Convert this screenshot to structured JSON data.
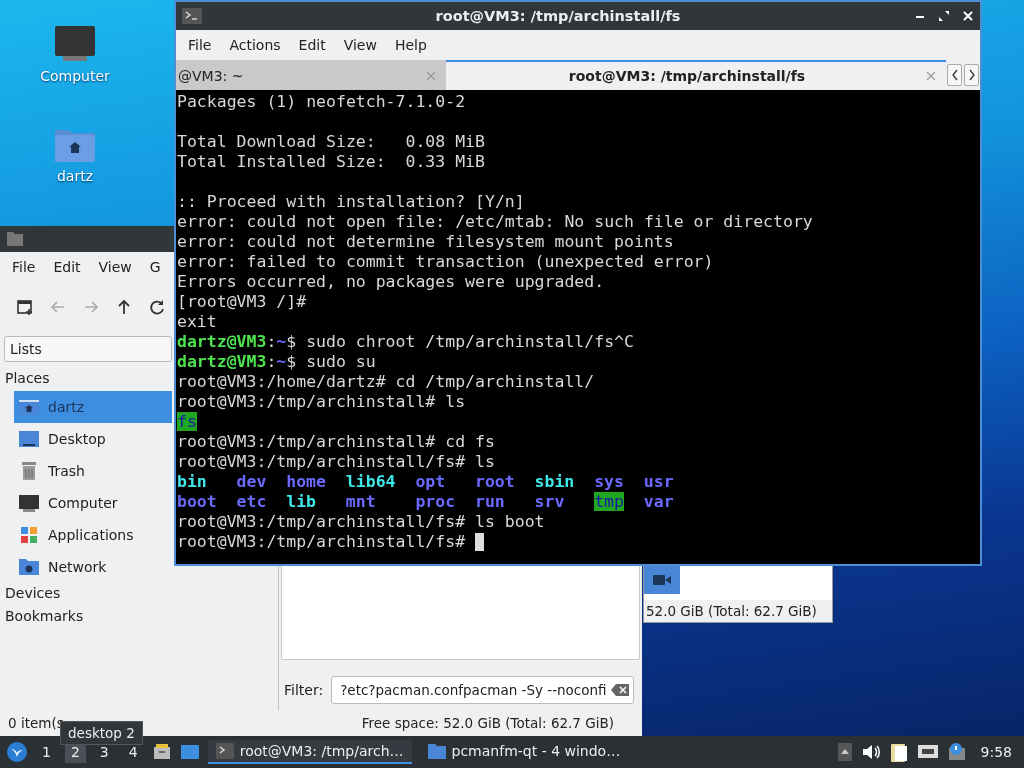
{
  "desktop_icons": [
    {
      "label": "Computer",
      "kind": "computer"
    },
    {
      "label": "dartz",
      "kind": "home"
    }
  ],
  "back_window": {
    "status": "52.0 GiB (Total: 62.7 GiB)"
  },
  "file_manager": {
    "menu": [
      "File",
      "Edit",
      "View",
      "G"
    ],
    "lists": "Lists",
    "places": {
      "label": "Places",
      "items": [
        {
          "label": "dartz",
          "selected": true
        },
        {
          "label": "Desktop",
          "selected": false
        },
        {
          "label": "Trash",
          "selected": false
        },
        {
          "label": "Computer",
          "selected": false
        },
        {
          "label": "Applications",
          "selected": false
        },
        {
          "label": "Network",
          "selected": false
        }
      ]
    },
    "sections": [
      "Devices",
      "Bookmarks"
    ],
    "filter": {
      "label": "Filter:",
      "value": "?etc?pacman.confpacman -Sy --noconfi"
    },
    "status": "0 item(s",
    "free_space": "Free space: 52.0 GiB (Total: 62.7 GiB)"
  },
  "terminal": {
    "title": "root@VM3: /tmp/archinstall/fs",
    "menu": [
      "File",
      "Actions",
      "Edit",
      "View",
      "Help"
    ],
    "tabs": [
      {
        "label": "@VM3: ~",
        "selected": false
      },
      {
        "label": "root@VM3: /tmp/archinstall/fs",
        "selected": true
      }
    ],
    "lines": [
      {
        "kind": "plain",
        "text": "Packages (1) neofetch-7.1.0-2"
      },
      {
        "kind": "blank"
      },
      {
        "kind": "plain",
        "text": "Total Download Size:   0.08 MiB"
      },
      {
        "kind": "plain",
        "text": "Total Installed Size:  0.33 MiB"
      },
      {
        "kind": "blank"
      },
      {
        "kind": "plain",
        "text": ":: Proceed with installation? [Y/n]"
      },
      {
        "kind": "plain",
        "text": "error: could not open file: /etc/mtab: No such file or directory"
      },
      {
        "kind": "plain",
        "text": "error: could not determine filesystem mount points"
      },
      {
        "kind": "plain",
        "text": "error: failed to commit transaction (unexpected error)"
      },
      {
        "kind": "plain",
        "text": "Errors occurred, no packages were upgraded."
      },
      {
        "kind": "plain",
        "text": "[root@VM3 /]#"
      },
      {
        "kind": "plain",
        "text": "exit"
      },
      {
        "kind": "prompt",
        "user": "dartz@VM3",
        "sep": ":",
        "path": "~",
        "command": "$ sudo chroot /tmp/archinstall/fs^C"
      },
      {
        "kind": "prompt",
        "user": "dartz@VM3",
        "sep": ":",
        "path": "~",
        "command": "$ sudo su"
      },
      {
        "kind": "plain",
        "text": "root@VM3:/home/dartz# cd /tmp/archinstall/"
      },
      {
        "kind": "plain",
        "text": "root@VM3:/tmp/archinstall# ls"
      },
      {
        "kind": "listing",
        "items": [
          {
            "text": "fs",
            "kind": "highlight"
          }
        ]
      },
      {
        "kind": "plain",
        "text": "root@VM3:/tmp/archinstall# cd fs"
      },
      {
        "kind": "plain",
        "text": "root@VM3:/tmp/archinstall/fs# ls"
      },
      {
        "kind": "listing",
        "items": [
          {
            "text": "bin",
            "kind": "link"
          },
          {
            "text": "dev",
            "kind": "dir"
          },
          {
            "text": "home",
            "kind": "dir"
          },
          {
            "text": "lib64",
            "kind": "link"
          },
          {
            "text": "opt",
            "kind": "dir"
          },
          {
            "text": "root",
            "kind": "dir"
          },
          {
            "text": "sbin",
            "kind": "link"
          },
          {
            "text": "sys",
            "kind": "dir"
          },
          {
            "text": "usr",
            "kind": "dir"
          }
        ]
      },
      {
        "kind": "listing",
        "items": [
          {
            "text": "boot",
            "kind": "dir"
          },
          {
            "text": "etc",
            "kind": "dir"
          },
          {
            "text": "lib",
            "kind": "link"
          },
          {
            "text": "mnt",
            "kind": "dir"
          },
          {
            "text": "proc",
            "kind": "dir"
          },
          {
            "text": "run",
            "kind": "dir"
          },
          {
            "text": "srv",
            "kind": "dir"
          },
          {
            "text": "tmp",
            "kind": "highlight"
          },
          {
            "text": "var",
            "kind": "dir"
          }
        ]
      },
      {
        "kind": "plain",
        "text": "root@VM3:/tmp/archinstall/fs# ls boot"
      },
      {
        "kind": "plain",
        "cursor": true,
        "text": "root@VM3:/tmp/archinstall/fs# "
      }
    ]
  },
  "tooltip": "desktop 2",
  "taskbar": {
    "workspaces": [
      {
        "label": "1",
        "selected": false
      },
      {
        "label": "2",
        "selected": true
      },
      {
        "label": "3",
        "selected": false
      },
      {
        "label": "4",
        "selected": false
      }
    ],
    "tasks": [
      {
        "label": "root@VM3: /tmp/arch…",
        "selected": true
      },
      {
        "label": "pcmanfm-qt - 4 windo…",
        "selected": false
      }
    ],
    "clock": "9:58"
  }
}
